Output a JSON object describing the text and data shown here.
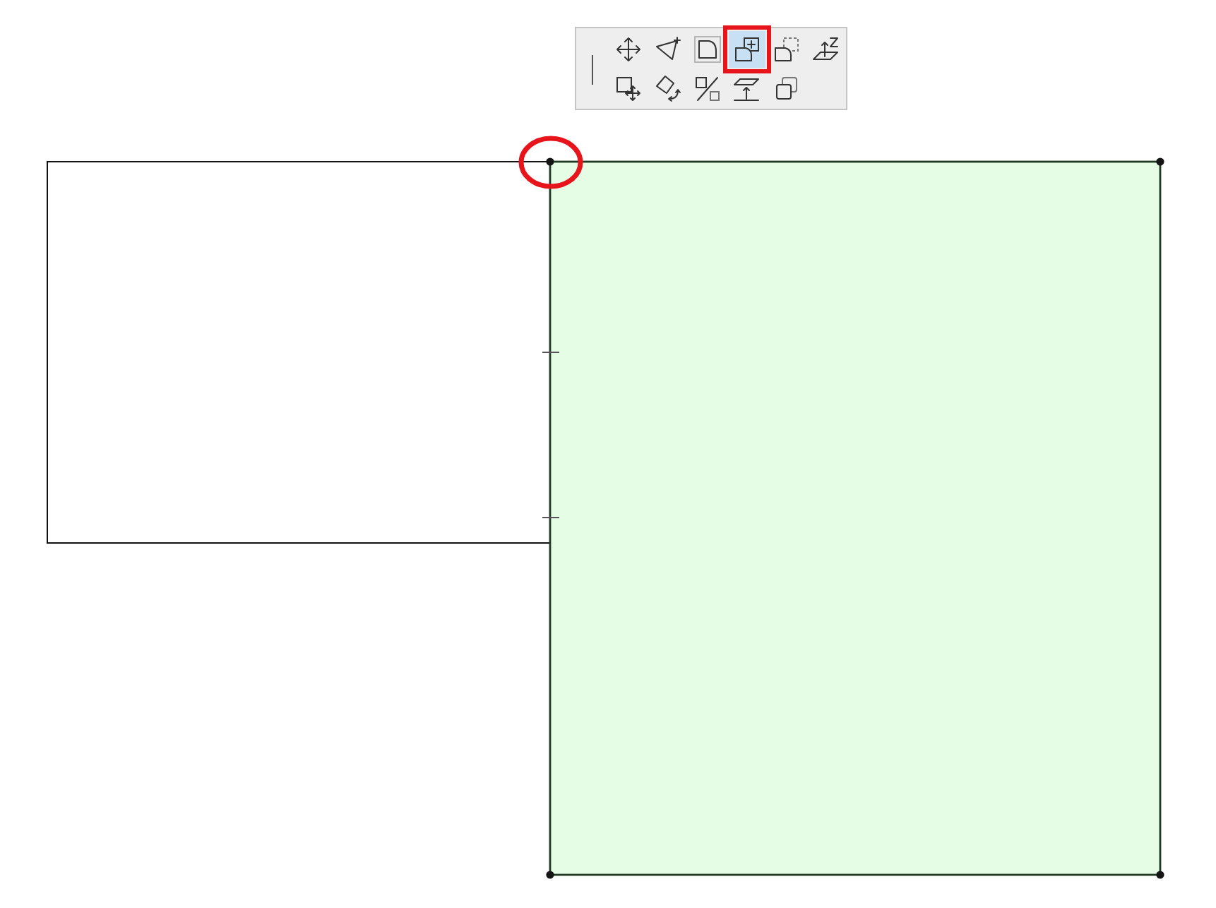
{
  "toolbar": {
    "buttons": [
      {
        "selected": false,
        "highlighted": false
      },
      {
        "selected": false,
        "highlighted": false
      },
      {
        "selected": false,
        "highlighted": false
      },
      {
        "selected": true,
        "highlighted": true
      },
      {
        "selected": false,
        "highlighted": false
      },
      {
        "selected": false,
        "highlighted": false
      },
      {
        "selected": false,
        "highlighted": false
      },
      {
        "selected": false,
        "highlighted": false
      },
      {
        "selected": false,
        "highlighted": false
      },
      {
        "selected": false,
        "highlighted": false
      },
      {
        "selected": false,
        "highlighted": false
      }
    ]
  },
  "canvas": {
    "shapes": [
      {
        "selected": false
      },
      {
        "selected": true
      }
    ],
    "annotations": [
      {
        "kind": "ellipse"
      }
    ]
  }
}
